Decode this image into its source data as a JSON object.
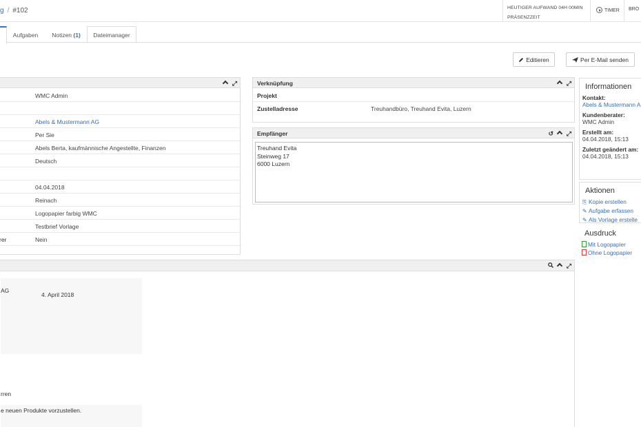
{
  "header": {
    "breadcrumb_link": "g",
    "breadcrumb_sep": "/",
    "breadcrumb_current": "#102",
    "effort_label": "HEUTIGER AUFWAND 04H 00MIN",
    "presence_label": "PRÄSENZZEIT",
    "timer_label": "TIMER",
    "bro_label": "BRO"
  },
  "tabs": [
    {
      "label": ""
    },
    {
      "label": "Aufgaben"
    },
    {
      "label": "Notizen",
      "count": "(1)"
    },
    {
      "label": "Dateimanager"
    }
  ],
  "actions": {
    "edit_label": "Editieren",
    "email_label": "Per E-Mail senden"
  },
  "details": {
    "rows": [
      {
        "label": "",
        "value": "WMC Admin"
      },
      {
        "label": "",
        "value": ""
      },
      {
        "label": "",
        "value": "Abels & Mustermann AG"
      },
      {
        "label": "",
        "value": "Per Sie"
      },
      {
        "label": "",
        "value": "Abels Berta, kaufmännische Angestellte, Finanzen"
      },
      {
        "label": "",
        "value": "Deutsch"
      },
      {
        "label": "",
        "value": ""
      },
      {
        "label": "",
        "value": "04.04.2018"
      },
      {
        "label": "",
        "value": "Reinach"
      },
      {
        "label": "",
        "value": "Logopapier farbig WMC"
      },
      {
        "label": "",
        "value": "Testbrief Vorlage"
      },
      {
        "label": "rer",
        "value": "Nein"
      }
    ]
  },
  "verknuepfung": {
    "title": "Verknüpfung",
    "project_label": "Projekt",
    "address_label": "Zustelladresse",
    "address_value": "Treuhandbüro, Treuhand Evita, Luzern"
  },
  "empfaenger": {
    "title": "Empfänger",
    "lines": [
      "Treuhand Evita",
      "Steinweg 17",
      "6000 Luzern"
    ]
  },
  "sidebar": {
    "info_title": "Informationen",
    "contact_label": "Kontakt:",
    "contact_value": "Abels & Mustermann A",
    "advisor_label": "Kundenberater:",
    "advisor_value": "WMC Admin",
    "created_label": "Erstellt am:",
    "created_value": "04.04.2018, 15:13",
    "changed_label": "Zuletzt geändert am:",
    "changed_value": "04.04.2018, 15:13",
    "actions_title": "Aktionen",
    "action_copy": "Kopie erstellen",
    "action_task": "Aufgabe erfassen",
    "action_template": "Als Vorlage erstelle",
    "print_title": "Ausdruck",
    "print_logo": "Mit Logopapier",
    "print_nologo": "Ohne Logopapier"
  },
  "document": {
    "line_ag": "AG",
    "date": "4. April 2018",
    "salutation": "rren",
    "body": "e neuen Produkte vorzustellen."
  },
  "colors": {
    "link": "#3a6fb0",
    "panel_header": "#f0f0f0",
    "border": "#dddddd"
  }
}
